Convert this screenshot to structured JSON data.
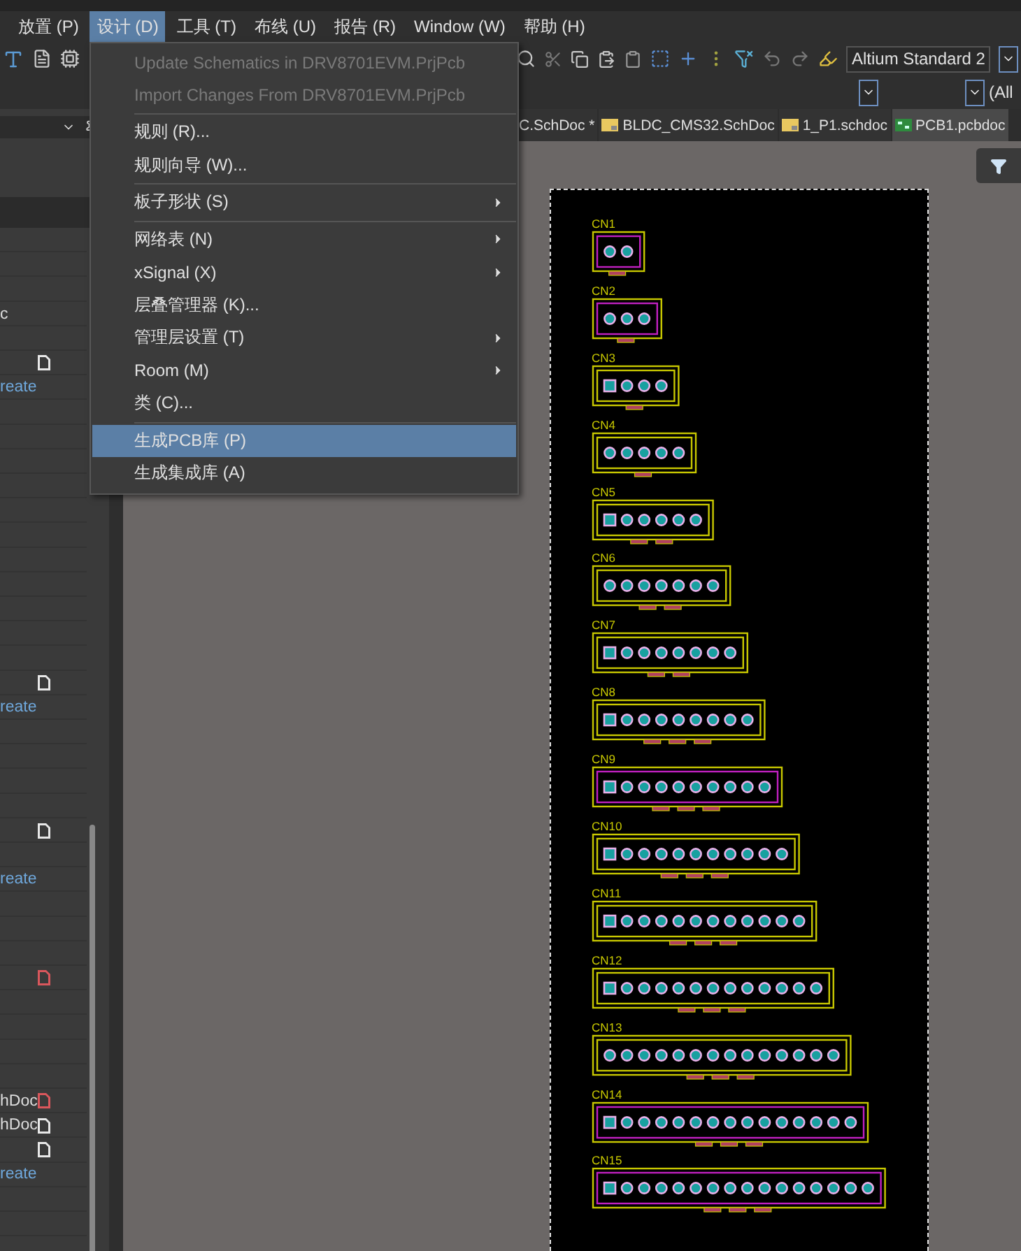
{
  "menu_bar": [
    {
      "label": "放置 (P)",
      "selected": false
    },
    {
      "label": "设计 (D)",
      "selected": true
    },
    {
      "label": "工具 (T)",
      "selected": false
    },
    {
      "label": "布线 (U)",
      "selected": false
    },
    {
      "label": "报告 (R)",
      "selected": false
    },
    {
      "label": "Window (W)",
      "selected": false
    },
    {
      "label": "帮助 (H)",
      "selected": false
    }
  ],
  "toolbar": {
    "font_field": "Altium Standard 2",
    "filter_field": "(All"
  },
  "dropdown": [
    {
      "kind": "item",
      "label": "Update Schematics in DRV8701EVM.PrjPcb",
      "disabled": true,
      "submenu": false,
      "selected": false
    },
    {
      "kind": "item",
      "label": "Import Changes From DRV8701EVM.PrjPcb",
      "disabled": true,
      "submenu": false,
      "selected": false
    },
    {
      "kind": "separator"
    },
    {
      "kind": "item",
      "label": "规则 (R)...",
      "disabled": false,
      "submenu": false,
      "selected": false
    },
    {
      "kind": "item",
      "label": "规则向导 (W)...",
      "disabled": false,
      "submenu": false,
      "selected": false
    },
    {
      "kind": "separator"
    },
    {
      "kind": "item",
      "label": "板子形状 (S)",
      "disabled": false,
      "submenu": true,
      "selected": false
    },
    {
      "kind": "separator"
    },
    {
      "kind": "item",
      "label": "网络表 (N)",
      "disabled": false,
      "submenu": true,
      "selected": false
    },
    {
      "kind": "item",
      "label": "xSignal (X)",
      "disabled": false,
      "submenu": true,
      "selected": false
    },
    {
      "kind": "item",
      "label": "层叠管理器 (K)...",
      "disabled": false,
      "submenu": false,
      "selected": false
    },
    {
      "kind": "item",
      "label": "管理层设置 (T)",
      "disabled": false,
      "submenu": true,
      "selected": false
    },
    {
      "kind": "item",
      "label": "Room (M)",
      "disabled": false,
      "submenu": true,
      "selected": false
    },
    {
      "kind": "item",
      "label": "类 (C)...",
      "disabled": false,
      "submenu": false,
      "selected": false
    },
    {
      "kind": "separator"
    },
    {
      "kind": "item",
      "label": "生成PCB库 (P)",
      "disabled": false,
      "submenu": false,
      "selected": true
    },
    {
      "kind": "item",
      "label": "生成集成库 (A)",
      "disabled": false,
      "submenu": false,
      "selected": false
    }
  ],
  "left_panel": {
    "rows": [
      {
        "kind": "blank"
      },
      {
        "kind": "blank"
      },
      {
        "kind": "blank"
      },
      {
        "kind": "entry",
        "text": "c"
      },
      {
        "kind": "blank"
      },
      {
        "kind": "entry",
        "file_icon": {
          "color": "#e8e8e8"
        }
      },
      {
        "kind": "entry",
        "text": "reate",
        "link": true
      },
      {
        "kind": "blank"
      },
      {
        "kind": "blank"
      },
      {
        "kind": "blank"
      },
      {
        "kind": "blank"
      },
      {
        "kind": "blank"
      },
      {
        "kind": "blank"
      },
      {
        "kind": "blank"
      },
      {
        "kind": "blank"
      },
      {
        "kind": "blank"
      },
      {
        "kind": "blank"
      },
      {
        "kind": "blank"
      },
      {
        "kind": "entry",
        "file_icon": {
          "color": "#e8e8e8"
        }
      },
      {
        "kind": "entry",
        "text": "reate",
        "link": true
      },
      {
        "kind": "blank"
      },
      {
        "kind": "blank"
      },
      {
        "kind": "blank"
      },
      {
        "kind": "blank"
      },
      {
        "kind": "entry",
        "file_icon": {
          "color": "#e8e8e8"
        }
      },
      {
        "kind": "blank"
      },
      {
        "kind": "entry",
        "text": "reate",
        "link": true
      },
      {
        "kind": "blank"
      },
      {
        "kind": "blank"
      },
      {
        "kind": "blank"
      },
      {
        "kind": "entry",
        "file_icon": {
          "color": "#d9575c"
        }
      },
      {
        "kind": "blank"
      },
      {
        "kind": "blank"
      },
      {
        "kind": "blank"
      },
      {
        "kind": "blank"
      },
      {
        "kind": "entry",
        "text": "hDoc",
        "file_icon": {
          "color": "#d9575c"
        }
      },
      {
        "kind": "entry",
        "text": "hDoc",
        "file_icon": {
          "color": "#e8e8e8"
        }
      },
      {
        "kind": "entry",
        "file_icon": {
          "color": "#e8e8e8"
        }
      },
      {
        "kind": "entry",
        "text": "reate",
        "link": true
      },
      {
        "kind": "blank"
      },
      {
        "kind": "blank"
      },
      {
        "kind": "blank"
      }
    ]
  },
  "tabs": [
    {
      "label": "C.SchDoc *",
      "kind": "schematic",
      "selected": false
    },
    {
      "label": "BLDC_CMS32.SchDoc",
      "kind": "schematic",
      "selected": false
    },
    {
      "label": "1_P1.schdoc",
      "kind": "schematic",
      "selected": false
    },
    {
      "label": "PCB1.pcbdoc",
      "kind": "pcb",
      "selected": true
    }
  ],
  "board": {
    "footprints": [
      {
        "designator": "CN1",
        "highlighted": true,
        "square_pin1": false
      },
      {
        "designator": "CN2",
        "highlighted": true,
        "square_pin1": false
      },
      {
        "designator": "CN3",
        "highlighted": false,
        "square_pin1": true
      },
      {
        "designator": "CN4",
        "highlighted": false,
        "square_pin1": false
      },
      {
        "designator": "CN5",
        "highlighted": false,
        "square_pin1": true
      },
      {
        "designator": "CN6",
        "highlighted": false,
        "square_pin1": false
      },
      {
        "designator": "CN7",
        "highlighted": false,
        "square_pin1": true
      },
      {
        "designator": "CN8",
        "highlighted": false,
        "square_pin1": true
      },
      {
        "designator": "CN9",
        "highlighted": true,
        "square_pin1": true
      },
      {
        "designator": "CN10",
        "highlighted": false,
        "square_pin1": true
      },
      {
        "designator": "CN11",
        "highlighted": false,
        "square_pin1": true
      },
      {
        "designator": "CN12",
        "highlighted": false,
        "square_pin1": true
      },
      {
        "designator": "CN13",
        "highlighted": false,
        "square_pin1": false
      },
      {
        "designator": "CN14",
        "highlighted": true,
        "square_pin1": true
      },
      {
        "designator": "CN15",
        "highlighted": true,
        "square_pin1": true
      }
    ]
  }
}
